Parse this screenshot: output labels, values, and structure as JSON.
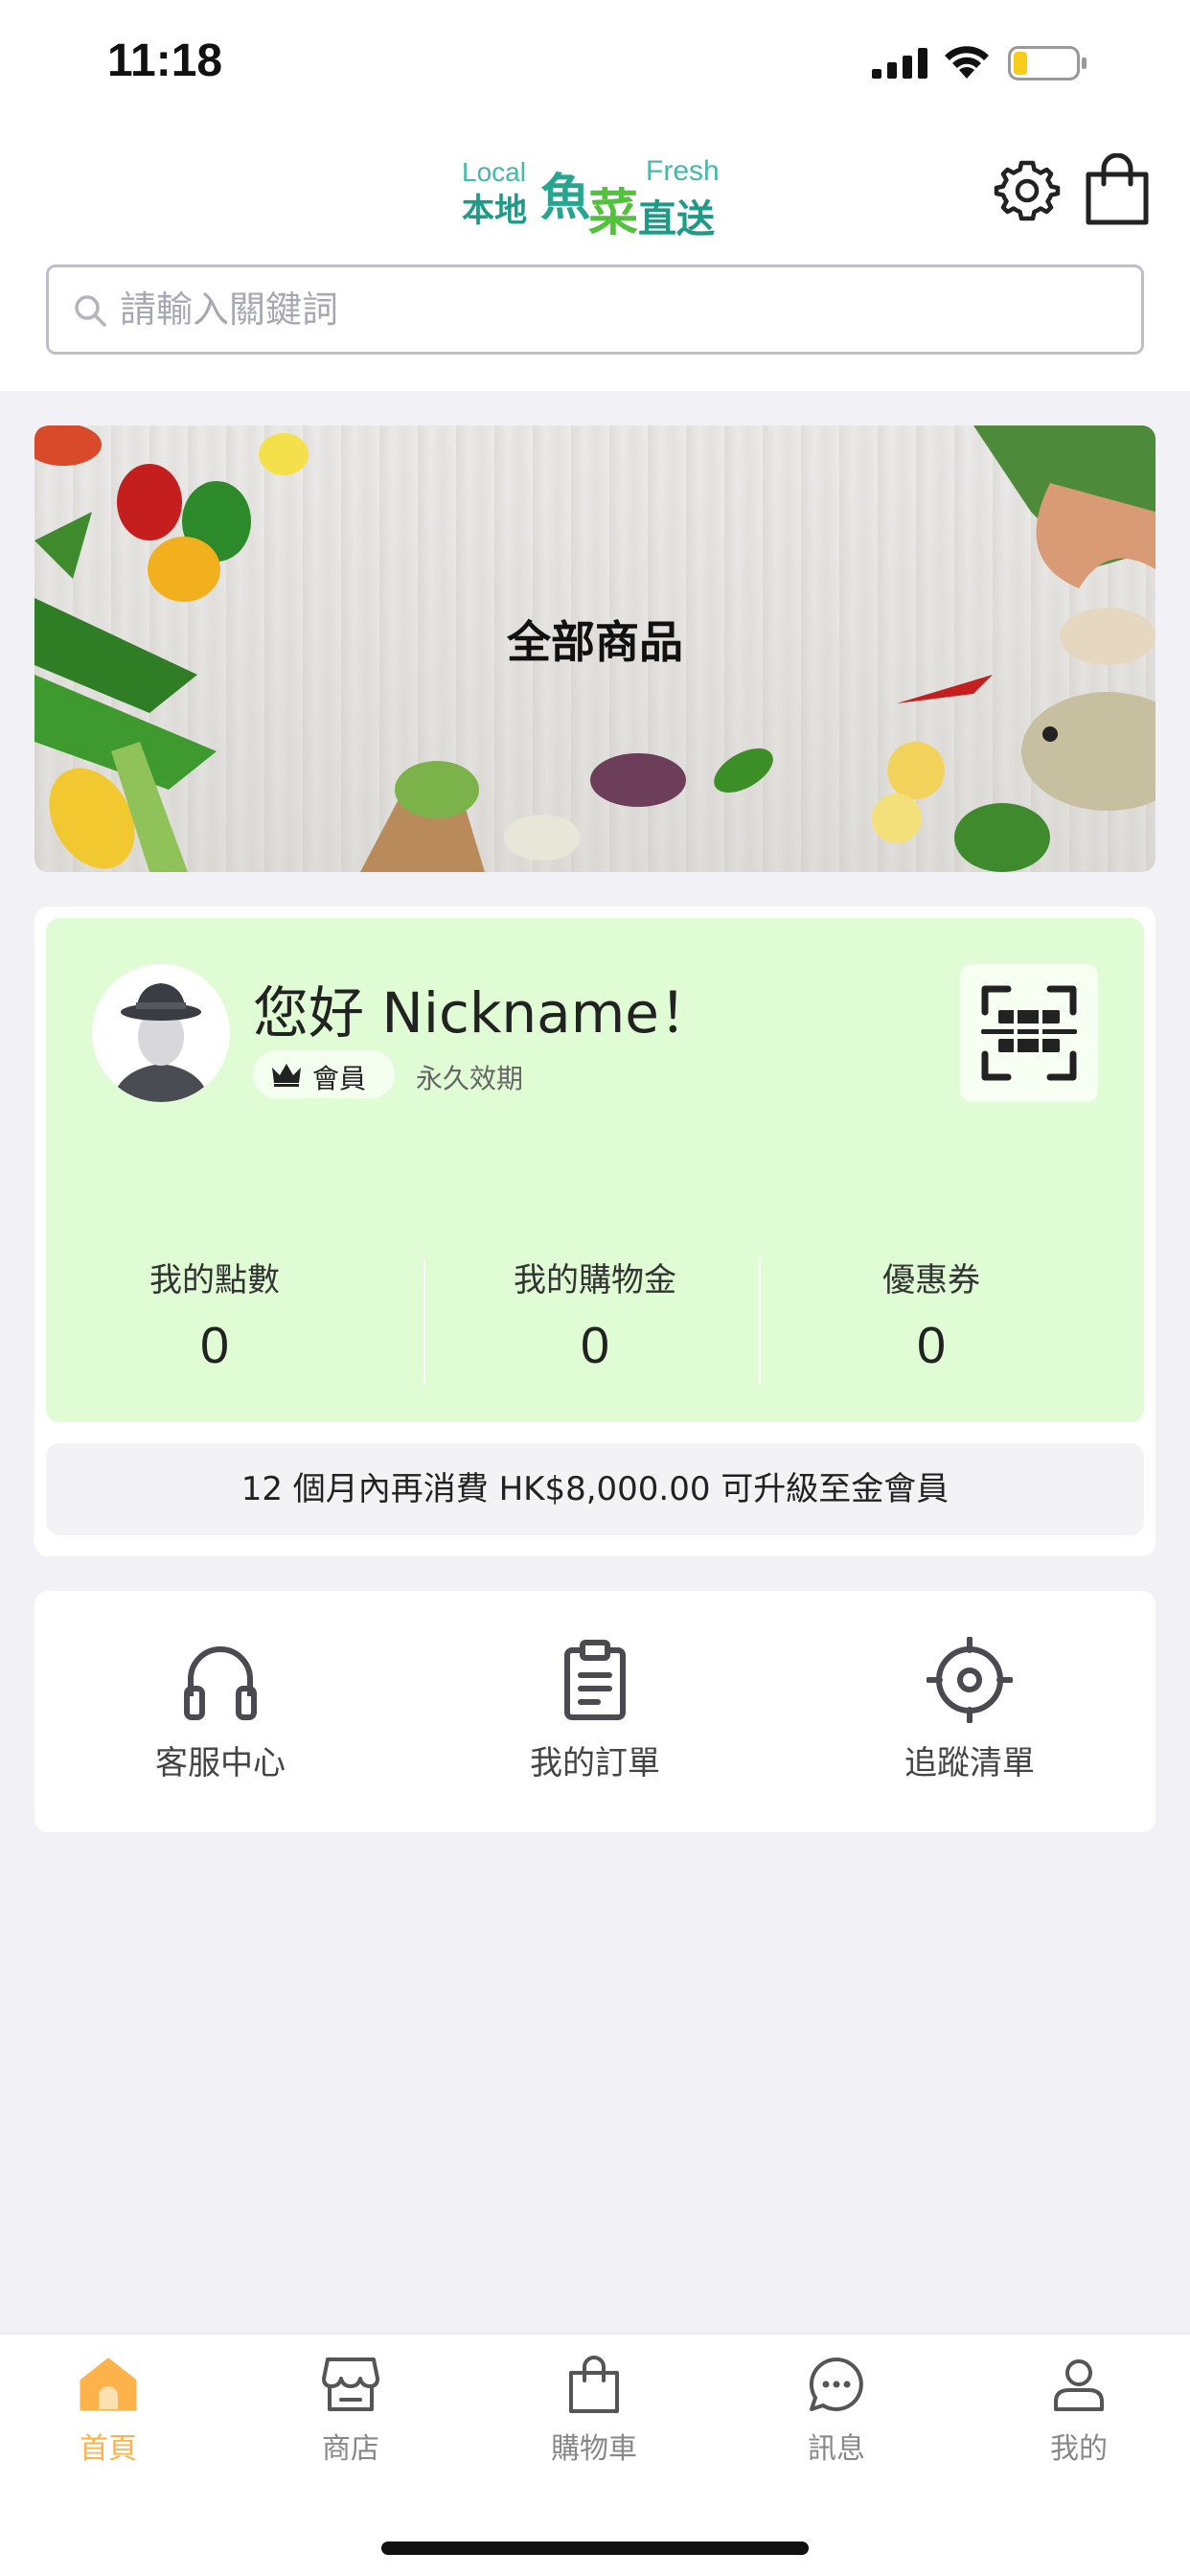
{
  "status_bar": {
    "time": "11:18",
    "icons": [
      "signal-icon",
      "wifi-icon",
      "battery-icon"
    ]
  },
  "header": {
    "logo": {
      "en_left": "Local",
      "zh_left": "本地",
      "zh_fish": "魚",
      "zh_veg": "菜",
      "en_right": "Fresh",
      "zh_right": "直送"
    },
    "icons": [
      "gear-icon",
      "shopping-bag-icon"
    ]
  },
  "search": {
    "placeholder": "請輸入關鍵詞",
    "value": ""
  },
  "banner": {
    "title": "全部商品"
  },
  "member": {
    "greeting": "您好 Nickname！",
    "badge": "會員",
    "validity": "永久效期",
    "stats": [
      {
        "label": "我的點數",
        "value": "0"
      },
      {
        "label": "我的購物金",
        "value": "0"
      },
      {
        "label": "優惠券",
        "value": "0"
      }
    ],
    "upgrade_text": "12 個月內再消費 HK$8,000.00 可升級至金會員"
  },
  "quick_links": [
    {
      "label": "客服中心",
      "icon": "headphones-icon"
    },
    {
      "label": "我的訂單",
      "icon": "clipboard-icon"
    },
    {
      "label": "追蹤清單",
      "icon": "target-icon"
    }
  ],
  "tabs": [
    {
      "label": "首頁",
      "icon": "home-icon",
      "active": true
    },
    {
      "label": "商店",
      "icon": "store-icon",
      "active": false
    },
    {
      "label": "購物車",
      "icon": "shopping-bag-icon",
      "active": false
    },
    {
      "label": "訊息",
      "icon": "chat-icon",
      "active": false
    },
    {
      "label": "我的",
      "icon": "user-icon",
      "active": false
    }
  ],
  "colors": {
    "accent": "#fdb24a",
    "member_card": "#dffcd5",
    "logo_green": "#27a58f",
    "background": "#f2f2f6"
  }
}
